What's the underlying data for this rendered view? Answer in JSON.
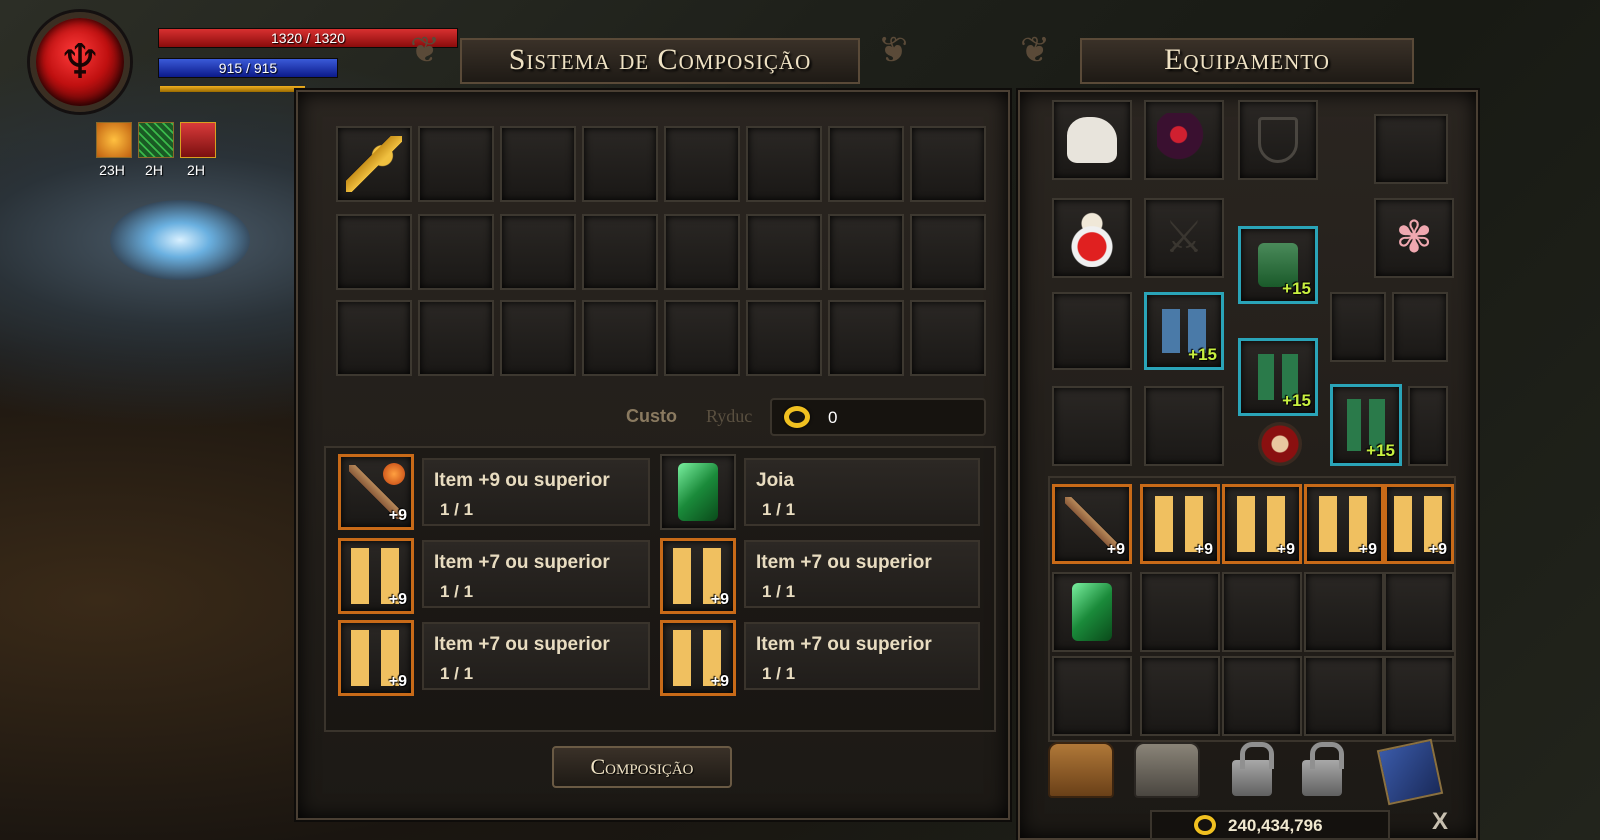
{
  "hud": {
    "hp_text": "1320 / 1320",
    "mp_text": "915 / 915",
    "hp_fraction": 1.0,
    "mp_fraction": 1.0,
    "buffs": [
      {
        "icon": "orange-rune-icon",
        "time": "23H",
        "color": "#e89018"
      },
      {
        "icon": "green-grid-icon",
        "time": "2H",
        "color": "#2a8a3a"
      },
      {
        "icon": "red-chest-icon",
        "time": "2H",
        "color": "#b82828"
      }
    ]
  },
  "compose": {
    "title": "Sistema de Composição",
    "cost_label": "Custo",
    "currency_label": "Ryduc",
    "cost_value": "0",
    "button": "Composição",
    "requirements": [
      {
        "item_icon": "halberd-icon",
        "item_level": "+9",
        "name": "Item +9 ou superior",
        "count": "1 / 1"
      },
      {
        "item_icon": "green-gem-icon",
        "item_level": "",
        "name": "Joia",
        "count": "1 / 1"
      },
      {
        "item_icon": "gold-greaves-icon",
        "item_level": "+9",
        "name": "Item +7 ou superior",
        "count": "1 / 1"
      },
      {
        "item_icon": "gold-greaves-icon",
        "item_level": "+9",
        "name": "Item +7 ou superior",
        "count": "1 / 1"
      },
      {
        "item_icon": "gold-greaves-icon",
        "item_level": "+9",
        "name": "Item +7 ou superior",
        "count": "1 / 1"
      },
      {
        "item_icon": "gold-greaves-icon",
        "item_level": "+9",
        "name": "Item +7 ou superior",
        "count": "1 / 1"
      }
    ]
  },
  "equipment": {
    "title": "Equipamento",
    "equipped_levels": [
      "+15",
      "+15",
      "+15",
      "+15"
    ],
    "bag_levels": [
      "+9",
      "+9",
      "+9",
      "+9",
      "+9"
    ],
    "gold": "240,434,796",
    "close": "X"
  }
}
